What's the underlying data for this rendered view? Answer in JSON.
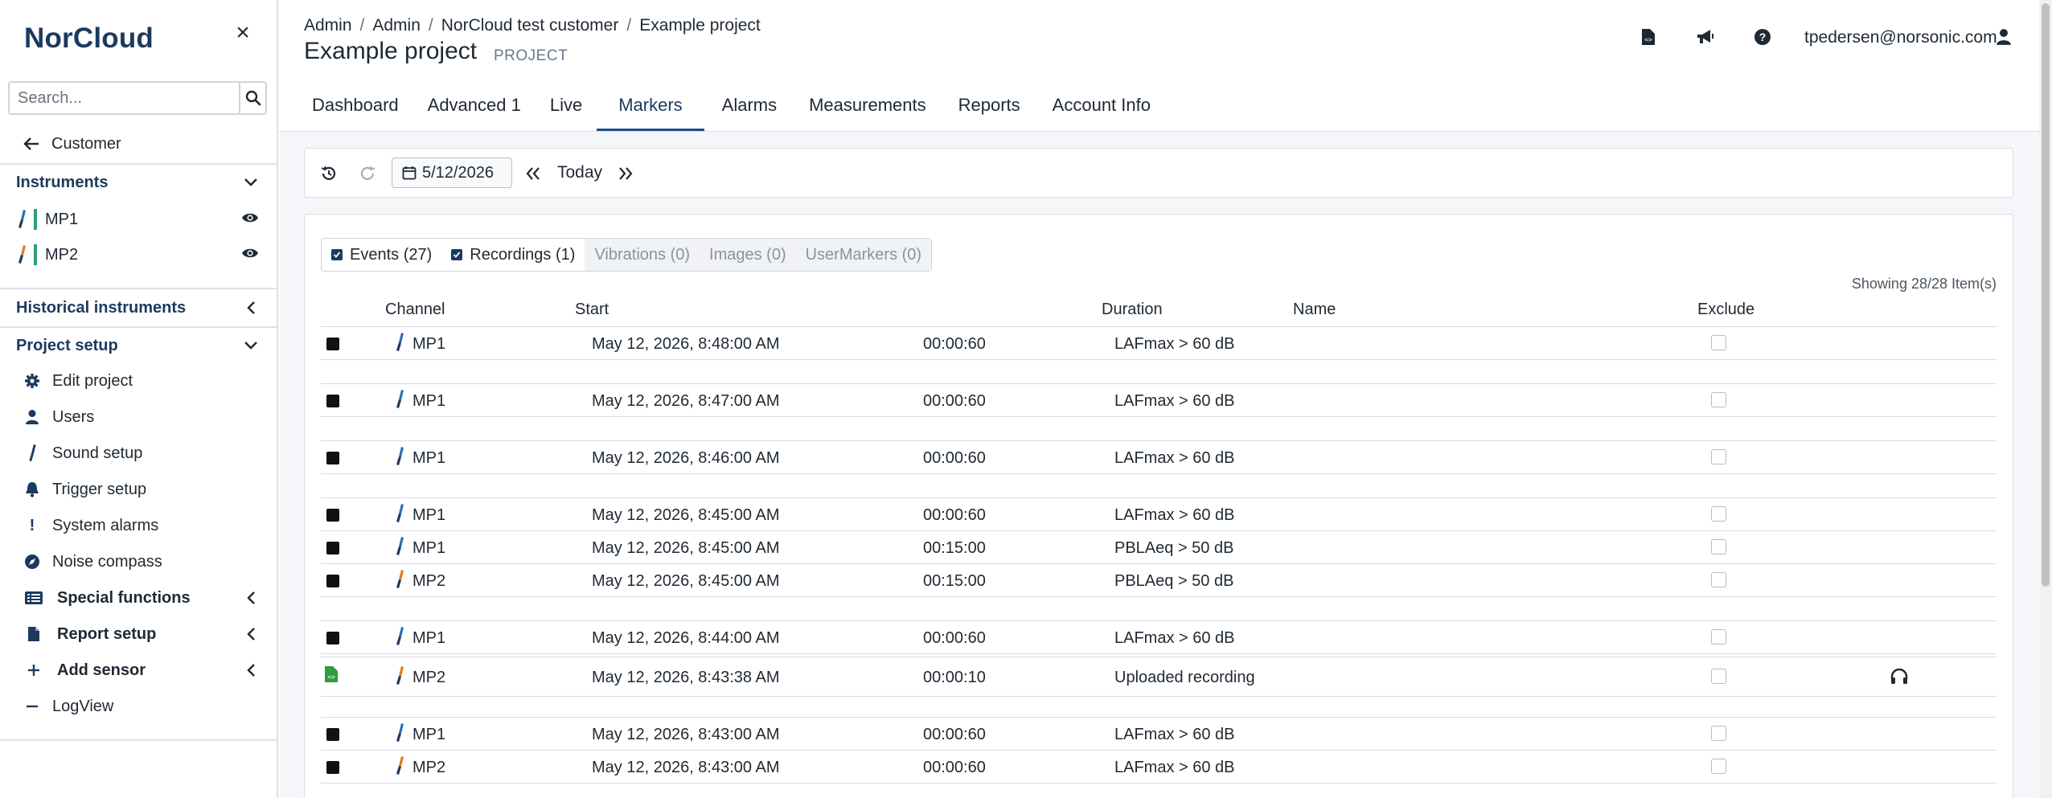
{
  "sidebar": {
    "brand": "NorCloud",
    "search_placeholder": "Search...",
    "back_label": "Customer",
    "instruments_header": "Instruments",
    "instruments": [
      {
        "label": "MP1",
        "color": "#2a6fb8"
      },
      {
        "label": "MP2",
        "color": "#e07b1a"
      }
    ],
    "historical_header": "Historical instruments",
    "project_setup_header": "Project setup",
    "items": [
      {
        "label": "Edit project",
        "icon": "gear-icon"
      },
      {
        "label": "Users",
        "icon": "user-icon"
      },
      {
        "label": "Sound setup",
        "icon": "microphone-icon"
      },
      {
        "label": "Trigger setup",
        "icon": "bell-icon"
      },
      {
        "label": "System alarms",
        "icon": "exclamation-icon"
      },
      {
        "label": "Noise compass",
        "icon": "compass-icon"
      },
      {
        "label": "Special functions",
        "icon": "list-icon"
      },
      {
        "label": "Report setup",
        "icon": "file-icon"
      },
      {
        "label": "Add sensor",
        "icon": "plus-icon"
      },
      {
        "label": "LogView",
        "icon": "minus-icon"
      }
    ]
  },
  "header": {
    "breadcrumbs": [
      "Admin",
      "Admin",
      "NorCloud test customer",
      "Example project"
    ],
    "title": "Example project",
    "kind": "PROJECT",
    "user_email": "tpedersen@norsonic.com"
  },
  "tabs": [
    {
      "label": "Dashboard",
      "active": false
    },
    {
      "label": "Advanced 1",
      "active": false
    },
    {
      "label": "Live",
      "active": false
    },
    {
      "label": "Markers",
      "active": true
    },
    {
      "label": "Alarms",
      "active": false
    },
    {
      "label": "Measurements",
      "active": false
    },
    {
      "label": "Reports",
      "active": false
    },
    {
      "label": "Account Info",
      "active": false
    }
  ],
  "toolbar": {
    "date": "5/12/2026",
    "today_label": "Today"
  },
  "filters": [
    {
      "label": "Events (27)",
      "checked": true
    },
    {
      "label": "Recordings (1)",
      "checked": true
    },
    {
      "label": "Vibrations (0)",
      "checked": false
    },
    {
      "label": "Images (0)",
      "checked": false
    },
    {
      "label": "UserMarkers (0)",
      "checked": false
    }
  ],
  "showing": "Showing 28/28 Item(s)",
  "table": {
    "columns": [
      "Channel",
      "Start",
      "Duration",
      "Name",
      "Exclude"
    ],
    "rows": [
      {
        "channel": "MP1",
        "start": "May 12, 2026, 8:48:00 AM",
        "duration": "00:00:60",
        "name": "LAFmax > 60 dB",
        "type": "event"
      },
      {
        "channel": "MP1",
        "start": "May 12, 2026, 8:47:00 AM",
        "duration": "00:00:60",
        "name": "LAFmax > 60 dB",
        "type": "event"
      },
      {
        "channel": "MP1",
        "start": "May 12, 2026, 8:46:00 AM",
        "duration": "00:00:60",
        "name": "LAFmax > 60 dB",
        "type": "event"
      },
      {
        "channel": "MP1",
        "start": "May 12, 2026, 8:45:00 AM",
        "duration": "00:00:60",
        "name": "LAFmax > 60 dB",
        "type": "event"
      },
      {
        "channel": "MP1",
        "start": "May 12, 2026, 8:45:00 AM",
        "duration": "00:15:00",
        "name": "PBLAeq > 50 dB",
        "type": "event"
      },
      {
        "channel": "MP2",
        "start": "May 12, 2026, 8:45:00 AM",
        "duration": "00:15:00",
        "name": "PBLAeq > 50 dB",
        "type": "event"
      },
      {
        "channel": "MP1",
        "start": "May 12, 2026, 8:44:00 AM",
        "duration": "00:00:60",
        "name": "LAFmax > 60 dB",
        "type": "event"
      },
      {
        "channel": "MP2",
        "start": "May 12, 2026, 8:43:38 AM",
        "duration": "00:00:10",
        "name": "Uploaded recording",
        "type": "recording"
      },
      {
        "channel": "MP1",
        "start": "May 12, 2026, 8:43:00 AM",
        "duration": "00:00:60",
        "name": "LAFmax > 60 dB",
        "type": "event"
      },
      {
        "channel": "MP2",
        "start": "May 12, 2026, 8:43:00 AM",
        "duration": "00:00:60",
        "name": "LAFmax > 60 dB",
        "type": "event"
      }
    ]
  },
  "colors": {
    "brand": "#1c3a5e",
    "tab_underline": "#1c4f86",
    "mp1": "#2a6fb8",
    "mp2": "#e07b1a",
    "recording_icon": "#2e9e3e"
  }
}
